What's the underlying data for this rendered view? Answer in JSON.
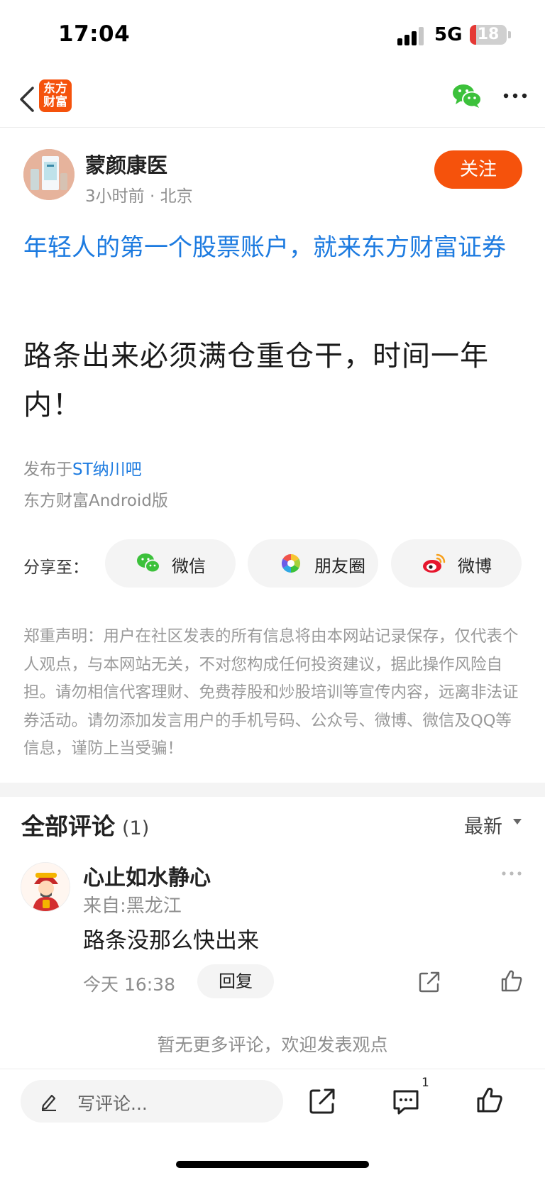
{
  "status_bar": {
    "time": "17:04",
    "network": "5G",
    "battery": "18",
    "battery_level_percent": 18
  },
  "nav": {
    "logo_text_line1": "东方",
    "logo_text_line2": "财富",
    "logo_color": "#f5520c"
  },
  "author": {
    "name": "蒙颜康医",
    "meta": "3小时前 · 北京",
    "follow_label": "关注"
  },
  "promo": {
    "text": "年轻人的第一个股票账户，就来东方财富证券"
  },
  "post": {
    "body": "路条出来必须满仓重仓干，时间一年内！",
    "published_prefix": "发布于",
    "forum": "ST纳川吧",
    "client": "东方财富Android版"
  },
  "share": {
    "label": "分享至：",
    "targets": [
      {
        "label": "微信",
        "icon": "wechat-icon"
      },
      {
        "label": "朋友圈",
        "icon": "moments-icon"
      },
      {
        "label": "微博",
        "icon": "weibo-icon"
      }
    ]
  },
  "disclaimer": "郑重声明：用户在社区发表的所有信息将由本网站记录保存，仅代表个人观点，与本网站无关，不对您构成任何投资建议，据此操作风险自担。请勿相信代客理财、免费荐股和炒股培训等宣传内容，远离非法证券活动。请勿添加发言用户的手机号码、公众号、微博、微信及QQ等信息，谨防上当受骗！",
  "comments": {
    "title": "全部评论",
    "count": "(1)",
    "sort": "最新",
    "items": [
      {
        "user": "心止如水静心",
        "location": "来自:黑龙江",
        "text": "路条没那么快出来",
        "time": "今天 16:38",
        "reply_label": "回复"
      }
    ],
    "no_more": "暂无更多评论，欢迎发表观点"
  },
  "bottom_bar": {
    "input_placeholder": "写评论...",
    "comment_badge": "1"
  },
  "colors": {
    "accent": "#f5520c",
    "link": "#1d7be0",
    "wechat_green": "#3cc13b"
  }
}
